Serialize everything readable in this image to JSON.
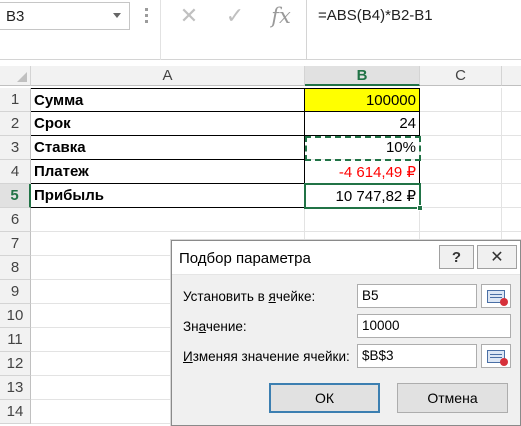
{
  "formula_bar": {
    "name_box": "B3",
    "formula": "=ABS(B4)*B2-B1",
    "cancel_icon": "close-icon",
    "confirm_icon": "check-icon",
    "fx_label": "fx"
  },
  "sheet": {
    "columns": [
      "A",
      "B",
      "C"
    ],
    "selected_column": "B",
    "selected_row": "5",
    "rows": [
      {
        "num": "1",
        "a": "Сумма",
        "b": "100000"
      },
      {
        "num": "2",
        "a": "Срок",
        "b": "24"
      },
      {
        "num": "3",
        "a": "Ставка",
        "b": "10%"
      },
      {
        "num": "4",
        "a": "Платеж",
        "b": "-4 614,49 ₽"
      },
      {
        "num": "5",
        "a": "Прибыль",
        "b": "10 747,82 ₽"
      },
      {
        "num": "6",
        "a": "",
        "b": ""
      },
      {
        "num": "7",
        "a": "",
        "b": ""
      },
      {
        "num": "8",
        "a": "",
        "b": ""
      },
      {
        "num": "9",
        "a": "",
        "b": ""
      },
      {
        "num": "10",
        "a": "",
        "b": ""
      },
      {
        "num": "11",
        "a": "",
        "b": ""
      },
      {
        "num": "12",
        "a": "",
        "b": ""
      },
      {
        "num": "13",
        "a": "",
        "b": ""
      },
      {
        "num": "14",
        "a": "",
        "b": ""
      }
    ],
    "colors": {
      "highlight": "#ffff00",
      "negative": "#ff0000",
      "selection": "#217346"
    }
  },
  "dialog": {
    "title": "Подбор параметра",
    "help_label": "?",
    "close_label": "✕",
    "set_cell_label_pre": "Установить в ",
    "set_cell_label_ul": "я",
    "set_cell_label_post": "чейке:",
    "set_cell_value": "B5",
    "value_label_pre": "Зн",
    "value_label_ul": "а",
    "value_label_post": "чение:",
    "value_value": "10000",
    "changing_label_ul": "И",
    "changing_label_post": "зменяя значение ячейки:",
    "changing_value": "$B$3",
    "ok_label": "ОК",
    "cancel_label": "Отмена"
  }
}
